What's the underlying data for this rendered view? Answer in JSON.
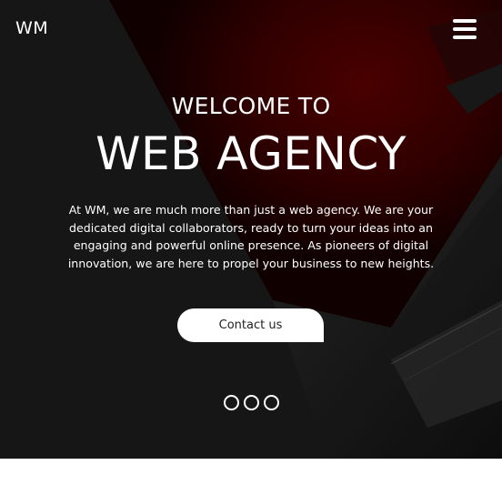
{
  "header": {
    "logo_text": "WM",
    "menu_icon": "hamburger-menu-icon"
  },
  "hero": {
    "welcome_text": "WELCOME TO",
    "title_text": "WEB AGENCY",
    "description": "At WM, we are much more than just a web agency. We are your dedicated digital collaborators, ready to turn your ideas into an engaging and powerful online presence. As pioneers of digital innovation, we are here to propel your business to new heights.",
    "cta_label": "Contact us",
    "slide_count": 3
  },
  "colors": {
    "hero_background": "#1c1c1c",
    "accent_red": "#4a0000",
    "text": "#ffffff",
    "button_background": "#ffffff",
    "button_text": "#222222",
    "page_background": "#ffffff"
  }
}
